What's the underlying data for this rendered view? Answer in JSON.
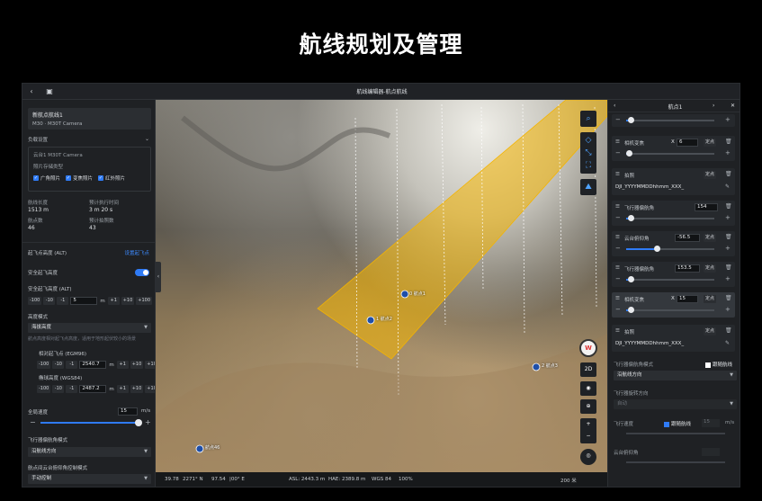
{
  "headline": "航线规划及管理",
  "titlebar": {
    "title": "航线编辑器-航点航线",
    "back_icon": "‹",
    "save_icon": "▣"
  },
  "left": {
    "route_name": "新航点航线1",
    "device": "M30 · M30T Camera",
    "payload_title": "负载设置",
    "payload_camera": "云台1 M30T Camera",
    "payload_desc": "照片存储类型",
    "photo_types": [
      "广角照片",
      "变焦照片",
      "红外照片"
    ],
    "stats": [
      {
        "key": "航线长度",
        "value": "1513 m"
      },
      {
        "key": "预计执行时间",
        "value": "3 m 20 s"
      },
      {
        "key": "航点数",
        "value": "46"
      },
      {
        "key": "预计拍照数",
        "value": "43"
      }
    ],
    "takeoff_alt_label": "起飞点高度 (ALT)",
    "takeoff_alt_link": "设置起飞点",
    "safe_takeoff_label": "安全起飞高度",
    "safe_alt_label": "安全起飞高度 (ALT)",
    "safe_alt_steps_minus": [
      "-100",
      "-10",
      "-1"
    ],
    "safe_alt_value": "5",
    "safe_alt_unit": "m",
    "safe_alt_steps_plus": [
      "+1",
      "+10",
      "+100"
    ],
    "alt_mode_label": "高度模式",
    "alt_mode_value": "海拔高度",
    "alt_mode_hint": "航点高度相对起飞点高度，适用于地形起伏较小的场景",
    "rel_alt_label": "相对起飞点 (EGM96)",
    "rel_alt_steps_minus": [
      "-100",
      "-10",
      "-1"
    ],
    "rel_alt_value": "2540.7",
    "rel_alt_unit": "m",
    "rel_alt_steps_plus": [
      "+1",
      "+10",
      "+100"
    ],
    "ellip_alt_label": "椭球高度 (WGS84)",
    "ellip_alt_steps_minus": [
      "-100",
      "-10",
      "-1"
    ],
    "ellip_alt_value": "2487.2",
    "ellip_alt_unit": "m",
    "ellip_alt_steps_plus": [
      "+1",
      "+10",
      "+100"
    ],
    "speed_label": "全局速度",
    "speed_value": "15",
    "speed_unit": "m/s",
    "speed_fraction": 0.97,
    "yaw_mode_label": "飞行器偏航角模式",
    "yaw_mode_value": "沿航线方向",
    "gimbal_mode_label": "航点间云台俯仰角控制模式",
    "gimbal_mode_value": "手动控制"
  },
  "map": {
    "waypoints": [
      "0 航点1",
      "1 航点2",
      "2 航点3",
      "航点46"
    ],
    "status": {
      "coord1": "39.78",
      "coord2": "2271° N",
      "coord3": "97.54",
      "coord4": "|00° E",
      "asl": "ASL: 2443.3 m",
      "hae": "HAE: 2389.8 m",
      "datum": "WGS 84",
      "zoom": "100%",
      "scale": "200 米"
    },
    "view_mode": "2D",
    "compass_letter": "W"
  },
  "right": {
    "header_title": "航点1",
    "actions": [
      {
        "label": "",
        "type": "slider",
        "value_fraction": 0.05
      },
      {
        "label": "相机变焦",
        "prefix": "X",
        "value": "6",
        "btn": "定点",
        "value_fraction": 0.03
      },
      {
        "label": "拍照",
        "btn": "定点",
        "file": "DJI_YYYYMMDDhhmm_XXX_"
      },
      {
        "label": "飞行器偏航角",
        "value": "154",
        "value_fraction": 0.05
      },
      {
        "label": "云台俯仰角",
        "value": "-56.5",
        "btn": "定点",
        "value_fraction": 0.35
      },
      {
        "label": "飞行器偏航角",
        "value": "153.5",
        "btn": "定点",
        "value_fraction": 0.05
      },
      {
        "label": "相机变焦",
        "prefix": "X",
        "value": "15",
        "btn": "定点",
        "value_fraction": 0.05
      },
      {
        "label": "拍照",
        "btn": "定点",
        "file": "DJI_YYYYMMDDhhmm_XXX_"
      }
    ],
    "yaw_mode_label": "飞行器偏航角模式",
    "follow_route_label": "跟随航线",
    "yaw_mode_value": "沿航线方向",
    "rotation_label": "飞行器旋转方向",
    "rotation_value": "自动",
    "speed_label": "飞行速度",
    "speed_follow": "跟随航线",
    "speed_value": "15",
    "speed_unit": "m/s",
    "gimbal_label": "云台俯仰角"
  }
}
